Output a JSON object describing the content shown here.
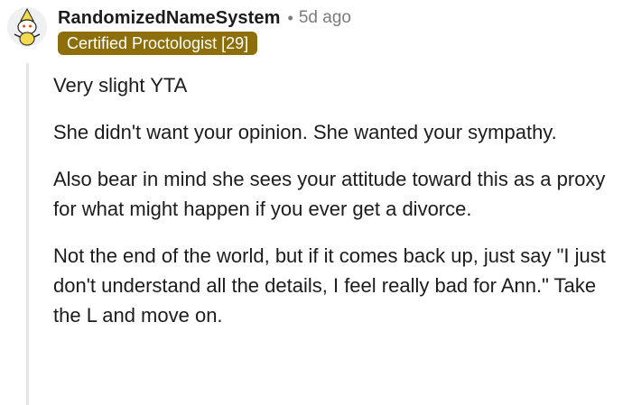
{
  "comment": {
    "username": "RandomizedNameSystem",
    "separator": "•",
    "timestamp": "5d ago",
    "flair": "Certified Proctologist [29]",
    "flair_color": "#8c6f0b",
    "avatar_icon": "snoo-avatar-icon",
    "paragraphs": [
      "Very slight YTA",
      "She didn't want your opinion. She wanted your sympathy.",
      "Also bear in mind she sees your attitude toward this as a proxy for what might happen if you ever get a divorce.",
      "Not the end of the world, but if it comes back up, just say \"I just don't understand all the details, I feel really bad for Ann.\" Take the L and move on."
    ]
  }
}
